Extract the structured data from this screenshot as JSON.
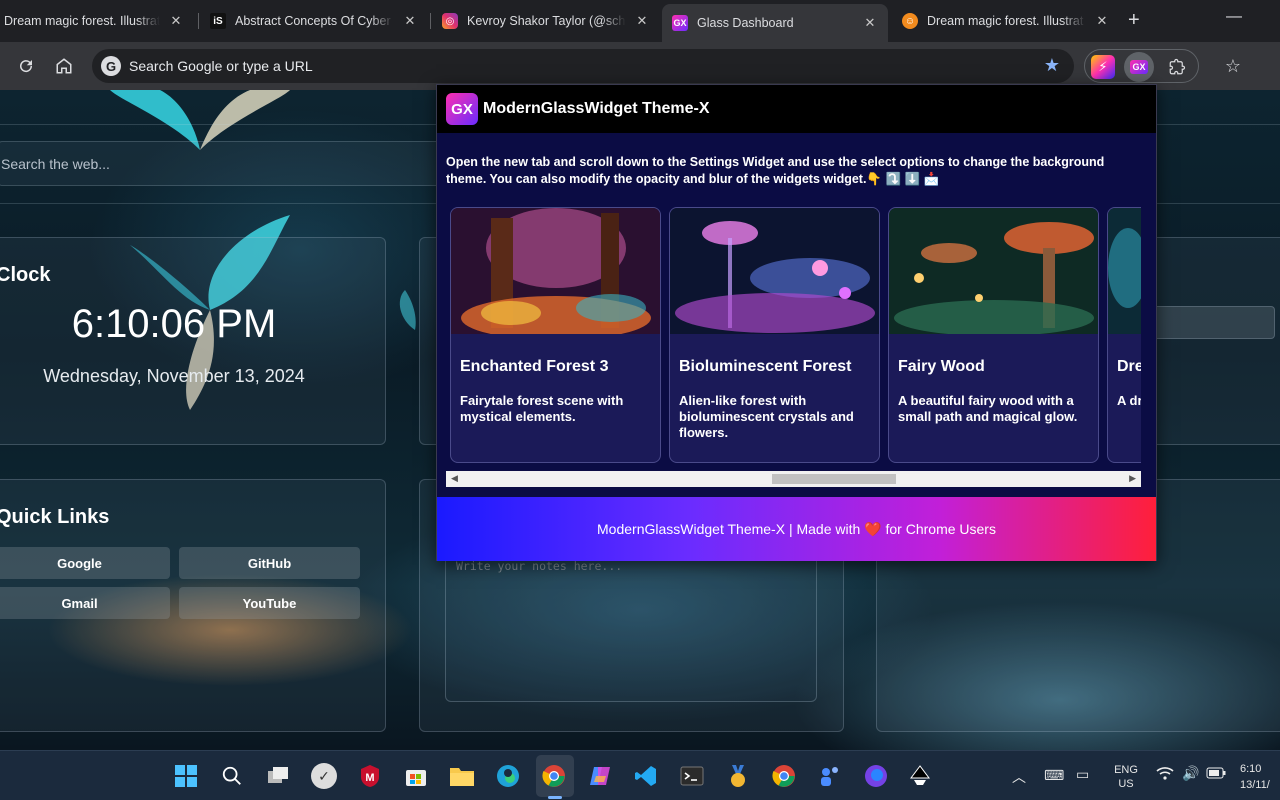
{
  "browser": {
    "tabs": [
      {
        "title": "Dream magic forest. Illustrat",
        "favicon": "dream-favicon",
        "active": false
      },
      {
        "title": "Abstract Concepts Of Cyber",
        "favicon": "iS",
        "active": false
      },
      {
        "title": "Kevroy Shakor Taylor (@scho",
        "favicon": "instagram-icon",
        "active": false
      },
      {
        "title": "Glass Dashboard",
        "favicon": "gx-icon",
        "active": true
      },
      {
        "title": "Dream magic forest. Illustrat",
        "favicon": "dream-favicon",
        "active": false
      }
    ],
    "omnibox_placeholder": "Search Google or type a URL",
    "google_letter": "G"
  },
  "dashboard": {
    "search_placeholder": "Search the web...",
    "clock": {
      "title": "Clock",
      "time": "6:10:06 PM",
      "date": "Wednesday, November 13, 2024"
    },
    "quick_links": {
      "title": "Quick Links",
      "links": [
        "Google",
        "GitHub",
        "Gmail",
        "YouTube"
      ]
    },
    "notes_placeholder": "Write your notes here..."
  },
  "popup": {
    "logo_text": "GX",
    "title": "ModernGlassWidget Theme-X",
    "description": "Open the new tab and scroll down to the Settings Widget and use the select options to change the background theme. You can also modify the opacity and blur of the widgets widget.👇 ⤵️ ⬇️ 📩",
    "cards": [
      {
        "title": "Enchanted Forest 3",
        "desc": "Fairytale forest scene with mystical elements."
      },
      {
        "title": "Bioluminescent Forest",
        "desc": "Alien-like forest with bioluminescent crystals and flowers."
      },
      {
        "title": "Fairy Wood",
        "desc": "A beautiful fairy wood with a small path and magical glow."
      },
      {
        "title": "Dre",
        "desc": "A dr illus"
      }
    ],
    "footer_left": "ModernGlassWidget Theme-X | Made with",
    "footer_heart": "❤️",
    "footer_right": "for Chrome Users"
  },
  "taskbar": {
    "lang_line1": "ENG",
    "lang_line2": "US",
    "time": "6:10",
    "date": "13/11/"
  },
  "colors": {
    "popup_bg": "#0b0c44",
    "card_bg": "#1b1a58",
    "footer_gradient_start": "#1a1aff",
    "footer_gradient_end": "#ff1f3a",
    "bookmark_star": "#8ab4f8"
  }
}
